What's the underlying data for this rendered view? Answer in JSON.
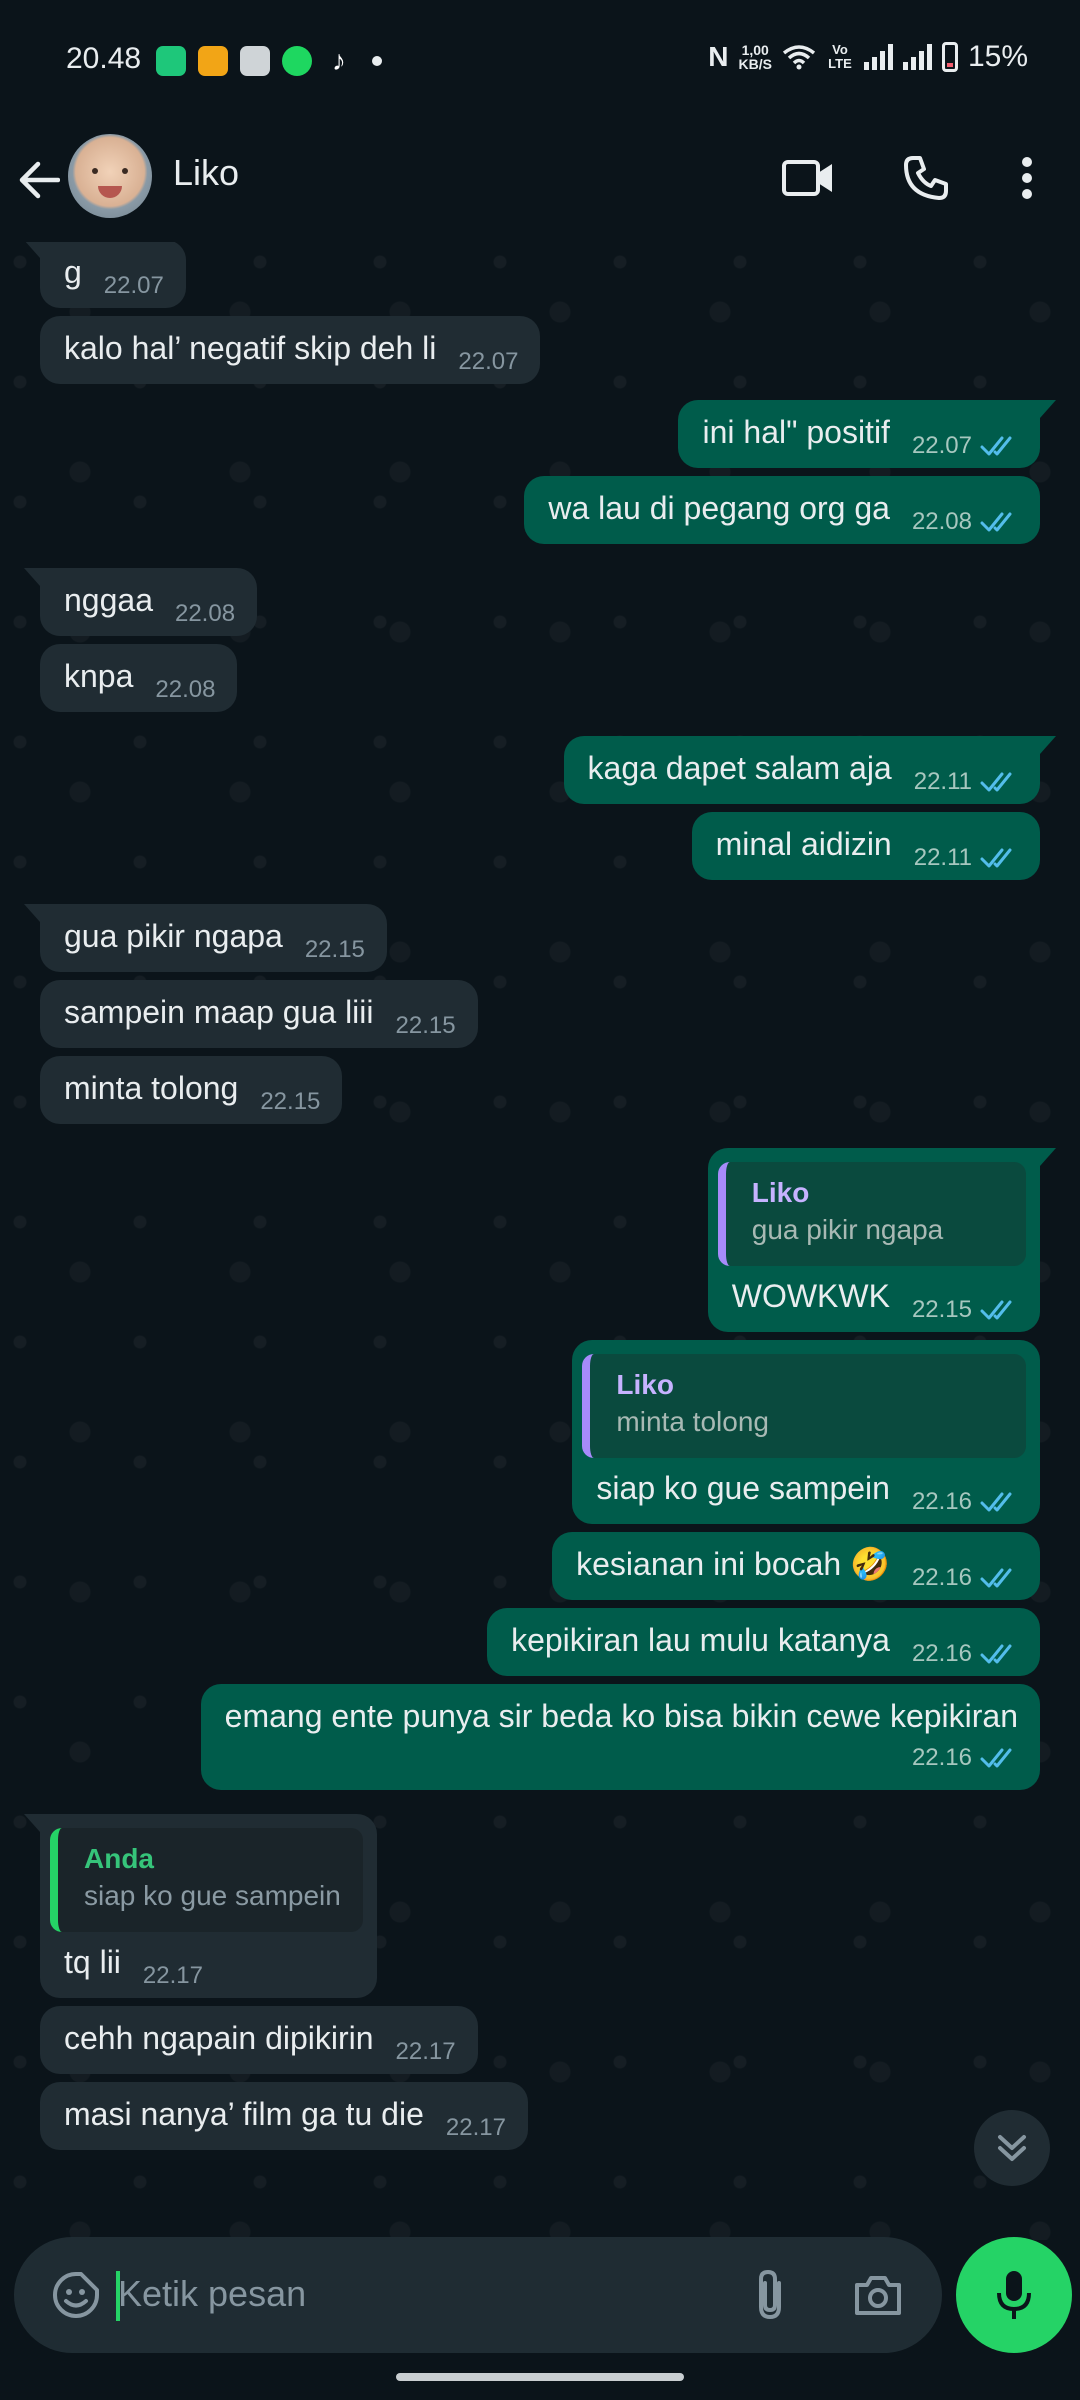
{
  "status_bar": {
    "time": "20.48",
    "net_speed_value": "1,00",
    "net_speed_unit": "KB/S",
    "volte": "Vo LTE",
    "battery": "15%",
    "app_icons": [
      "green-app-icon",
      "shopee-food-icon",
      "shopping-bag-icon",
      "spotify-icon",
      "tiktok-icon"
    ]
  },
  "header": {
    "contact_name": "Liko",
    "icons": [
      "back-arrow-icon",
      "video-call-icon",
      "phone-icon",
      "more-options-icon"
    ]
  },
  "messages": [
    {
      "dir": "in",
      "text": "g",
      "time": "22.07"
    },
    {
      "dir": "in",
      "text": "kalo hal’ negatif skip deh li",
      "time": "22.07"
    },
    {
      "dir": "out",
      "text": "ini hal\" positif",
      "time": "22.07",
      "read": true
    },
    {
      "dir": "out",
      "text": "wa lau di pegang org ga",
      "time": "22.08",
      "read": true
    },
    {
      "dir": "in",
      "text": "nggaa",
      "time": "22.08"
    },
    {
      "dir": "in",
      "text": "knpa",
      "time": "22.08"
    },
    {
      "dir": "out",
      "text": "kaga dapet salam aja",
      "time": "22.11",
      "read": true
    },
    {
      "dir": "out",
      "text": "minal aidizin",
      "time": "22.11",
      "read": true
    },
    {
      "dir": "in",
      "text": "gua pikir ngapa",
      "time": "22.15"
    },
    {
      "dir": "in",
      "text": "sampein maap gua liii",
      "time": "22.15"
    },
    {
      "dir": "in",
      "text": "minta tolong",
      "time": "22.15"
    },
    {
      "dir": "out",
      "text": "WOWKWK",
      "time": "22.15",
      "read": true,
      "quote_author": "Liko",
      "quote_text": "gua pikir ngapa"
    },
    {
      "dir": "out",
      "text": "siap ko gue sampein",
      "time": "22.16",
      "read": true,
      "quote_author": "Liko",
      "quote_text": "minta tolong"
    },
    {
      "dir": "out",
      "text": "kesianan ini bocah 🤣",
      "time": "22.16",
      "read": true
    },
    {
      "dir": "out",
      "text": "kepikiran lau mulu katanya",
      "time": "22.16",
      "read": true
    },
    {
      "dir": "out",
      "text": "emang ente punya sir beda ko bisa bikin cewe kepikiran",
      "time": "22.16",
      "read": true
    },
    {
      "dir": "in",
      "text": "tq lii",
      "time": "22.17",
      "quote_author": "Anda",
      "quote_text": "siap ko gue sampein"
    },
    {
      "dir": "in",
      "text": "cehh ngapain dipikirin",
      "time": "22.17"
    },
    {
      "dir": "in",
      "text": "masi nanya’ film ga tu die",
      "time": "22.17"
    }
  ],
  "composer": {
    "placeholder": "Ketik pesan",
    "icons": [
      "emoji-sticker-icon",
      "paperclip-icon",
      "camera-icon",
      "microphone-icon"
    ]
  },
  "colors": {
    "background": "#0b141a",
    "incoming_bubble": "#202c33",
    "outgoing_bubble": "#005c4b",
    "accent_green": "#25d366",
    "read_ticks": "#53bdeb"
  }
}
